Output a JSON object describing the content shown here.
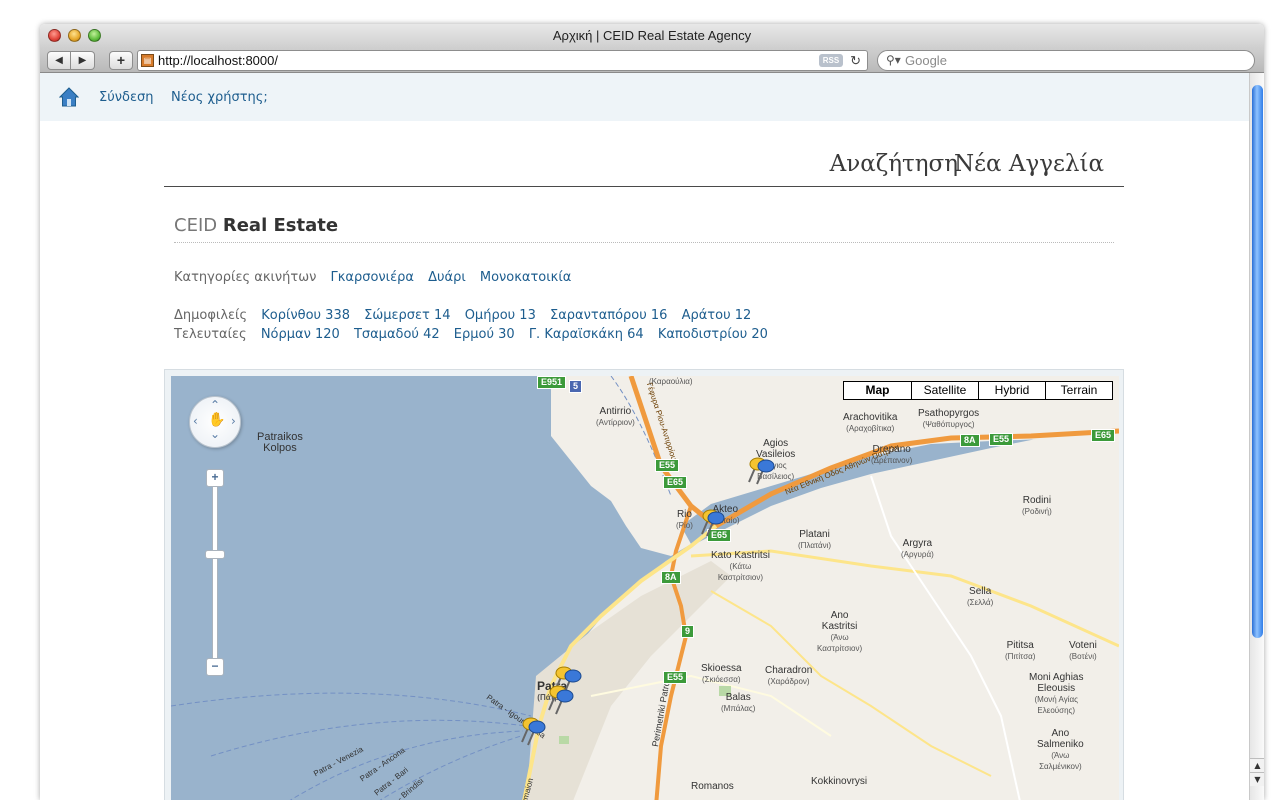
{
  "browser": {
    "window_title": "Αρχική | CEID Real Estate Agency",
    "url": "http://localhost:8000/",
    "rss_label": "RSS",
    "search_placeholder": "Google"
  },
  "topnav": {
    "login": "Σύνδεση",
    "register": "Νέος χρήστης;"
  },
  "mainnav": {
    "search": "Αναζήτηση",
    "new_listing": "Νέα Αγγελία"
  },
  "logo": {
    "prefix": "CEID",
    "name": "Real Estate"
  },
  "categories": {
    "label": "Κατηγορίες ακινήτων",
    "items": [
      "Γκαρσονιέρα",
      "Δυάρι",
      "Μονοκατοικία"
    ]
  },
  "popular": {
    "label": "Δημοφιλείς",
    "items": [
      "Κορίνθου 338",
      "Σώμερσετ 14",
      "Ομήρου 13",
      "Σαρανταπόρου 16",
      "Αράτου 12"
    ]
  },
  "latest": {
    "label": "Τελευταίες",
    "items": [
      "Νόρμαν 120",
      "Τσαμαδού 42",
      "Ερμού 30",
      "Γ. Καραϊσκάκη 64",
      "Καποδιστρίου 20"
    ]
  },
  "map": {
    "types": [
      "Map",
      "Satellite",
      "Hybrid",
      "Terrain"
    ],
    "selected_type": "Map",
    "places": {
      "gulf": "Patraikos\nKolpos",
      "antirrio": "Antirrio",
      "antirrio_gr": "(Αντίρριον)",
      "karavola_gr": "(Καραούλια)",
      "arachovitika": "Arachovitika",
      "arachovitika_gr": "(Αραχοβίτικα)",
      "psathopyrgos": "Psathopyrgos",
      "psathopyrgos_gr": "(Ψαθόπυργος)",
      "agios_vasileios": "Agios\nVasileios",
      "agios_vasileios_gr": "(Άγιος\nΒασίλειος)",
      "drepano": "Drepano",
      "drepano_gr": "(Δρέπανον)",
      "rio": "Rio",
      "rio_gr": "(Ρίο)",
      "akteo": "Akteo",
      "akteo_gr": "(Ακταίο)",
      "rodini": "Rodini",
      "rodini_gr": "(Ροδινή)",
      "platani": "Platani",
      "platani_gr": "(Πλατάνι)",
      "kato_kastritsi": "Kato Kastritsi",
      "kato_kastritsi_gr": "(Κάτω\nΚαστρίτσιον)",
      "argyra": "Argyra",
      "argyra_gr": "(Αργυρά)",
      "sella": "Sella",
      "sella_gr": "(Σελλά)",
      "ano_kastritsi": "Ano\nKastritsi",
      "ano_kastritsi_gr": "(Άνω\nΚαστρίτσιον)",
      "pititsa": "Pititsa",
      "pititsa_gr": "(Πιτίτσα)",
      "voteni": "Voteni",
      "voteni_gr": "(Βοτένι)",
      "skioessa": "Skioessa",
      "skioessa_gr": "(Σκιόεσσα)",
      "charadron": "Charadron",
      "charadron_gr": "(Χαράδρον)",
      "balas": "Balas",
      "balas_gr": "(Μπάλας)",
      "moni": "Moni Aghias\nEleousis",
      "moni_gr": "(Μονή Αγίας\nΕλεούσης)",
      "ano_salmeniko": "Ano\nSalmeniko",
      "ano_salmeniko_gr": "(Άνω\nΣαλμένικον)",
      "patra": "Patra",
      "patra_gr": "(Πάτρα)",
      "romanos": "Romanos",
      "kokkinovrysi": "Kokkinovrysi"
    },
    "roads": {
      "bridge": "Γέφυρα Ρίου-Αντιρρίου",
      "national": "Νέα Εθνική Οδός Αθηνών Πατρών",
      "perimetriki": "Perimetriki Patron",
      "ferry1": "Patra - Venezia",
      "ferry2": "Patra - Ancona",
      "ferry3": "Patra - Bari",
      "ferry4": "Patra - Brindisi",
      "ferry5": "Patra - Igoumenitsa",
      "dymaion": "Dymaion"
    },
    "shields": {
      "e951": "E951",
      "five": "5",
      "e55a": "E55",
      "e65a": "E65",
      "e55b": "E55",
      "e65b": "E65",
      "e8a": "8A",
      "e65c": "E65",
      "e8ab": "8A",
      "nine": "9",
      "e55c": "E55"
    }
  },
  "colors": {
    "link": "#1d5d8e",
    "water": "#99b3cc",
    "land": "#f2efe9",
    "motorway": "#f09a3e",
    "major_road": "#fde58a",
    "pin_yellow": "#f4c430",
    "pin_blue": "#3a78d8"
  }
}
